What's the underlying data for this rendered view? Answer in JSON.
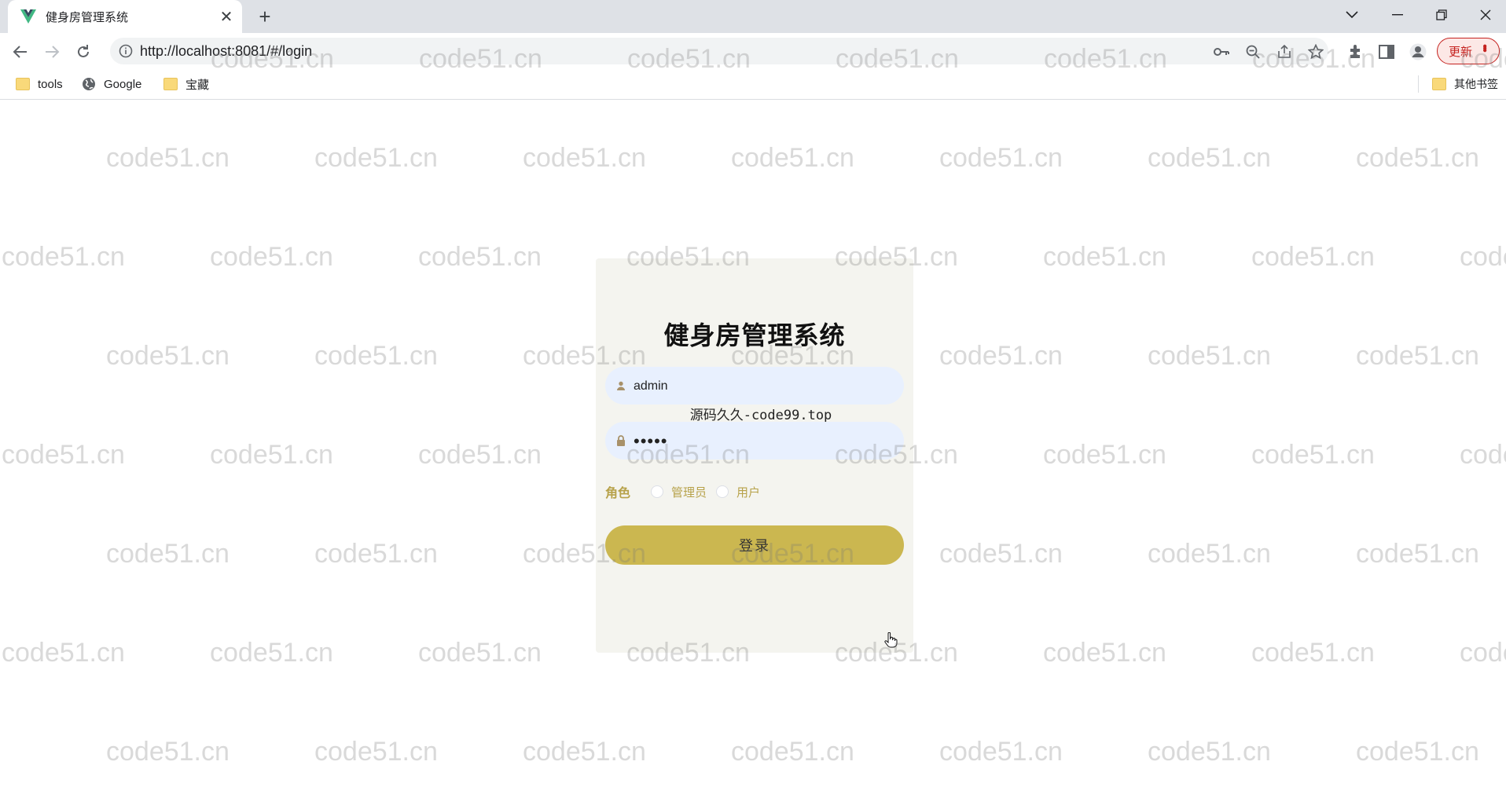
{
  "browser": {
    "tab_title": "健身房管理系统",
    "url": "http://localhost:8081/#/login",
    "update_label": "更新",
    "bookmarks": [
      {
        "label": "tools",
        "icon": "folder-icon"
      },
      {
        "label": "Google",
        "icon": "globe-icon"
      },
      {
        "label": "宝藏",
        "icon": "folder-icon"
      }
    ],
    "other_bookmarks": "其他书签"
  },
  "login": {
    "title": "健身房管理系统",
    "username_value": "admin",
    "password_value": "•••••",
    "note": "源码久久-code99.top",
    "role_label": "角色",
    "role_options": [
      "管理员",
      "用户"
    ],
    "submit_label": "登录"
  },
  "watermark": {
    "text": "code51.cn",
    "color": "#9a9a9a"
  },
  "colors": {
    "accent": "#cbb750",
    "role_text": "#b7a24a",
    "card_bg": "#f4f4ef",
    "input_bg": "#e8f0fe"
  }
}
